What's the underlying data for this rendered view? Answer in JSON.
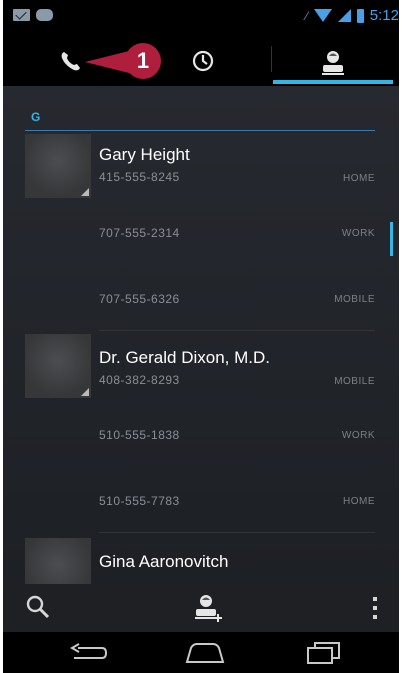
{
  "status_bar": {
    "time": "5:12",
    "left_icons": [
      "mail-icon",
      "message-icon"
    ],
    "right_icons": [
      "signal-small-icon",
      "wifi-icon",
      "cell-signal-icon",
      "battery-icon"
    ]
  },
  "tabs": [
    {
      "name": "phone",
      "icon": "phone-icon",
      "selected": false
    },
    {
      "name": "recent",
      "icon": "clock-icon",
      "selected": false
    },
    {
      "name": "contacts",
      "icon": "person-icon",
      "selected": true
    }
  ],
  "callout": {
    "number": "1",
    "color": "#b01e3e"
  },
  "section": {
    "letter": "G"
  },
  "contacts": [
    {
      "name": "Gary Height",
      "numbers": [
        {
          "number": "415-555-8245",
          "type": "HOME"
        },
        {
          "number": "707-555-2314",
          "type": "WORK"
        },
        {
          "number": "707-555-6326",
          "type": "MOBILE"
        }
      ]
    },
    {
      "name": "Dr. Gerald Dixon, M.D.",
      "numbers": [
        {
          "number": "408-382-8293",
          "type": "MOBILE"
        },
        {
          "number": "510-555-1838",
          "type": "WORK"
        },
        {
          "number": "510-555-7783",
          "type": "HOME"
        }
      ]
    },
    {
      "name": "Gina Aaronovitch",
      "numbers": [
        {
          "number": "",
          "type": ""
        }
      ]
    }
  ],
  "action_bar": [
    "search-icon",
    "add-contact-icon",
    "overflow-menu-icon"
  ],
  "nav_bar": [
    "back-icon",
    "home-icon",
    "recent-apps-icon"
  ],
  "colors": {
    "accent": "#33b5e5",
    "callout": "#b01e3e",
    "background": "#22252a"
  }
}
